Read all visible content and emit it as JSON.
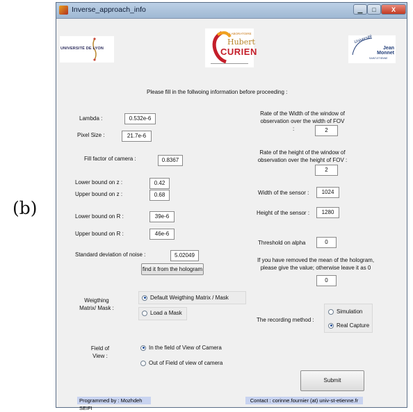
{
  "figure_label": "(b)",
  "window": {
    "title": "Inverse_approach_info",
    "controls": {
      "close": "X"
    }
  },
  "logos": {
    "lyon": "UNIVERSITÉ DE LYON",
    "hubert": {
      "line1": "LABORATOIRE",
      "line2": "Hubert",
      "line3": "CURIEN"
    },
    "jean_monnet": {
      "arc": "Université",
      "name": "Jean Monnet",
      "sub": "SAINT-ETIENNE"
    }
  },
  "instruction": "Please fill in the follwoing information before proceeding :",
  "fields": {
    "lambda": {
      "label": "Lambda :",
      "value": "0.532e-6"
    },
    "pixel_size": {
      "label": "Pixel Size :",
      "value": "21.7e-6"
    },
    "fill_factor": {
      "label": "Fill factor of camera :",
      "value": "0.8367"
    },
    "lower_z": {
      "label": "Lower bound on z :",
      "value": "0.42"
    },
    "upper_z": {
      "label": "Upper bound on z :",
      "value": "0.68"
    },
    "lower_r": {
      "label": "Lower bound on R :",
      "value": "39e-6"
    },
    "upper_r": {
      "label": "Upper bound on R :",
      "value": "46e-6"
    },
    "noise": {
      "label": "Standard deviation of noise :",
      "value": "5.02049"
    },
    "width_rate": {
      "label_l1": "Rate of the Width of the window of",
      "label_l2": "observation over the width of FOV",
      "label_l3": ":",
      "value": "2"
    },
    "height_rate": {
      "label_l1": "Rate of the height of the window of",
      "label_l2": "observation over the height of FOV :",
      "value": "2"
    },
    "sensor_width": {
      "label": "Width of the sensor :",
      "value": "1024"
    },
    "sensor_height": {
      "label": "Height of the sensor :",
      "value": "1280"
    },
    "alpha": {
      "label": "Threshold on alpha",
      "value": "0"
    },
    "mean": {
      "label_l1": "If you have removed the mean of the hologram,",
      "label_l2": "please give the value; otherwise leave it as 0",
      "value": "0"
    }
  },
  "buttons": {
    "find_noise": "find it from the hologram",
    "submit": "Submit"
  },
  "weighting": {
    "label_l1": "Weigthing",
    "label_l2": "Matrix/ Mask :",
    "options": [
      "Default Weigthing Matrix / Mask",
      "Load a Mask"
    ],
    "selected": 0
  },
  "recording": {
    "label": "The recording method :",
    "options": [
      "Simulation",
      "Real Capture"
    ],
    "selected": 1
  },
  "fov": {
    "label_l1": "Field of",
    "label_l2": "View :",
    "options": [
      "In the field of View of Camera",
      "Out of Field of view of camera"
    ],
    "selected": 0
  },
  "footer": {
    "programmer": "Programmed by : Mozhdeh SEIFI",
    "contact": "Contact : corinne.fournier (at) univ-st-etienne.fr"
  },
  "colors": {
    "titlebar": "#a9c0db",
    "footer_bg": "#c8d3f0",
    "window_bg": "#f0f0f0"
  }
}
